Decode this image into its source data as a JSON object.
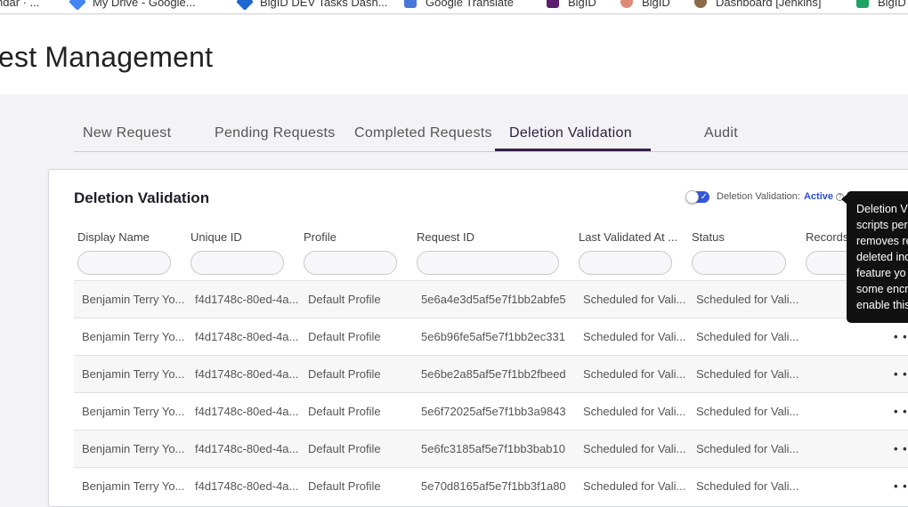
{
  "bookmarks": [
    {
      "label": "ndar · ...",
      "color": "#888888"
    },
    {
      "label": "My Drive - Google...",
      "color": "#4285f4"
    },
    {
      "label": "BigID DEV Tasks Dash...",
      "color": "#1e66d0"
    },
    {
      "label": "Google Translate",
      "color": "#4a78d8"
    },
    {
      "label": "BigID",
      "color": "#5b1e6e"
    },
    {
      "label": "BigID",
      "color": "#e08a7a"
    },
    {
      "label": "Dashboard [Jenkins]",
      "color": "#8a6a4a"
    },
    {
      "label": "BigID",
      "color": "#1ea362"
    }
  ],
  "header": {
    "title": "est Management"
  },
  "tabs": [
    {
      "label": "New Request"
    },
    {
      "label": "Pending Requests"
    },
    {
      "label": "Completed Requests"
    },
    {
      "label": "Deletion Validation",
      "active": true
    },
    {
      "label": "Audit"
    }
  ],
  "card": {
    "title": "Deletion Validation",
    "toggle_label": "Deletion Validation:",
    "toggle_state": "Active",
    "info_glyph": "?",
    "toggle_check": "✓"
  },
  "table": {
    "columns": [
      "Display Name",
      "Unique ID",
      "Profile",
      "Request ID",
      "Last Validated At ...",
      "Status",
      "Records"
    ],
    "rows": [
      [
        "Benjamin Terry Yo...",
        "f4d1748c-80ed-4a...",
        "Default Profile",
        "5e6a4e3d5af5e7f1bb2abfe5",
        "Scheduled for Vali...",
        "Scheduled for Vali...",
        ""
      ],
      [
        "Benjamin Terry Yo...",
        "f4d1748c-80ed-4a...",
        "Default Profile",
        "5e6b96fe5af5e7f1bb2ec331",
        "Scheduled for Vali...",
        "Scheduled for Vali...",
        "• •"
      ],
      [
        "Benjamin Terry Yo...",
        "f4d1748c-80ed-4a...",
        "Default Profile",
        "5e6be2a85af5e7f1bb2fbeed",
        "Scheduled for Vali...",
        "Scheduled for Vali...",
        "• •"
      ],
      [
        "Benjamin Terry Yo...",
        "f4d1748c-80ed-4a...",
        "Default Profile",
        "5e6f72025af5e7f1bb3a9843",
        "Scheduled for Vali...",
        "Scheduled for Vali...",
        "• •"
      ],
      [
        "Benjamin Terry Yo...",
        "f4d1748c-80ed-4a...",
        "Default Profile",
        "5e6fc3185af5e7f1bb3bab10",
        "Scheduled for Vali...",
        "Scheduled for Vali...",
        "• •"
      ],
      [
        "Benjamin Terry Yo...",
        "f4d1748c-80ed-4a...",
        "Default Profile",
        "5e70d8165af5e7f1bb3f1a80",
        "Scheduled for Vali...",
        "Scheduled for Vali...",
        "• •"
      ]
    ]
  },
  "tooltip": {
    "lines": [
      "Deletion V",
      "scripts per",
      "removes re",
      "deleted ind",
      "feature yo",
      "some encr",
      "enable this"
    ]
  }
}
